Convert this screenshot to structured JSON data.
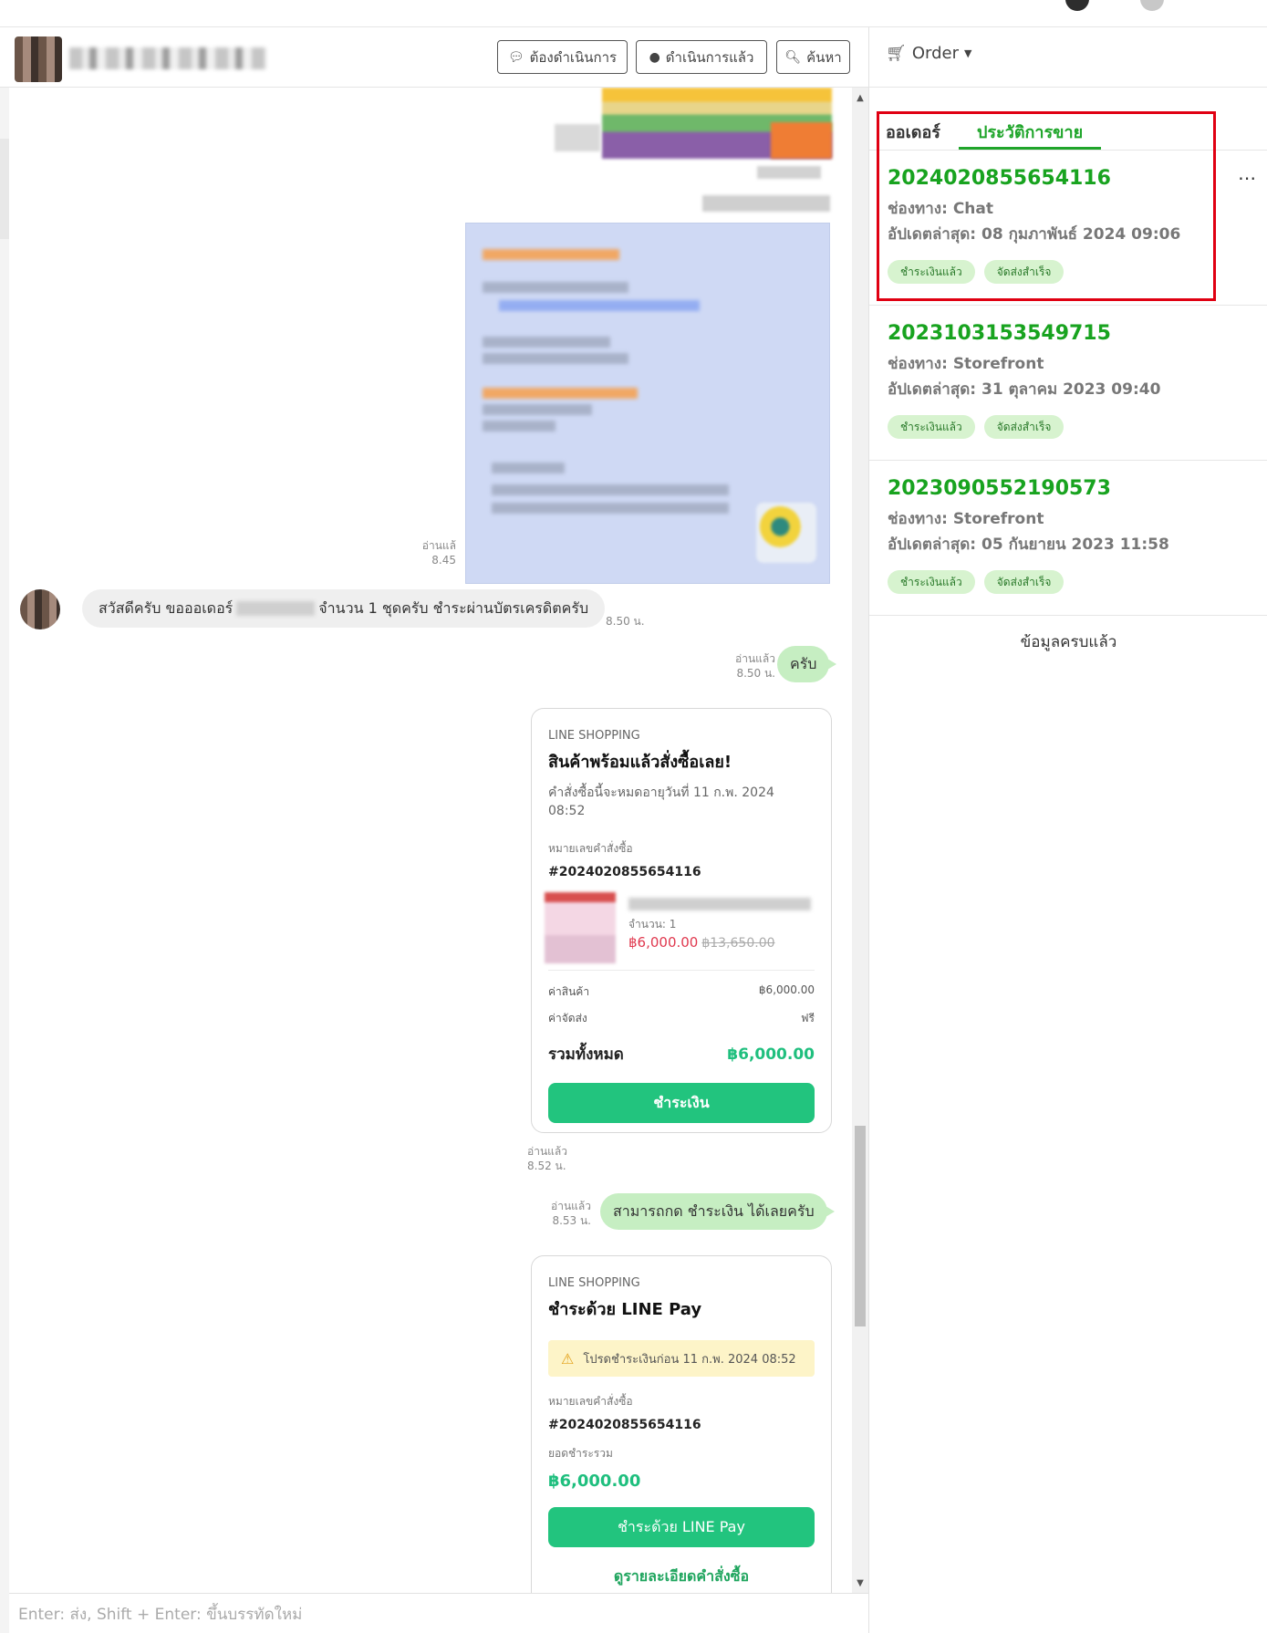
{
  "header": {
    "btn_pending": "ต้องดำเนินการ",
    "btn_done": "ดำเนินการแล้ว",
    "btn_search": "ค้นหา"
  },
  "chat": {
    "read_1_label": "อ่านแล้",
    "read_1_time": "8.45",
    "incoming_msg_a": "สวัสดีครับ ขอออเดอร์",
    "incoming_msg_b": "จำนวน 1 ชุดครับ ชำระผ่านบัตรเครดิตครับ",
    "incoming_time": "8.50 น.",
    "read_2_label": "อ่านแล้ว",
    "read_2_time": "8.50 น.",
    "out_1": "ครับ",
    "card1": {
      "source": "LINE SHOPPING",
      "title": "สินค้าพร้อมแล้วสั่งซื้อเลย!",
      "expiry": "คำสั่งซื้อนี้จะหมดอายุวันที่ 11 ก.พ. 2024 08:52",
      "order_label": "หมายเลขคำสั่งซื้อ",
      "order_no": "#2024020855654116",
      "qty": "จำนวน: 1",
      "price": "฿6,000.00",
      "price_old": "฿13,650.00",
      "subtotal_label": "ค่าสินค้า",
      "subtotal_value": "฿6,000.00",
      "shipping_label": "ค่าจัดส่ง",
      "shipping_value": "ฟรี",
      "total_label": "รวมทั้งหมด",
      "total_value": "฿6,000.00",
      "pay_button": "ชำระเงิน"
    },
    "read_3_label": "อ่านแล้ว",
    "read_3_time": "8.52 น.",
    "read_4_label": "อ่านแล้ว",
    "read_4_time": "8.53 น.",
    "out_2": "สามารถกด ชำระเงิน ได้เลยครับ",
    "card2": {
      "source": "LINE SHOPPING",
      "title": "ชำระด้วย LINE Pay",
      "warning": "โปรดชำระเงินก่อน 11 ก.พ. 2024 08:52",
      "order_label": "หมายเลขคำสั่งซื้อ",
      "order_no": "#2024020855654116",
      "amount_label": "ยอดชำระรวม",
      "amount": "฿6,000.00",
      "pay_button": "ชำระด้วย LINE Pay",
      "detail_link": "ดูรายละเอียดคำสั่งซื้อ"
    },
    "input_placeholder": "Enter: ส่ง, Shift + Enter: ขึ้นบรรทัดใหม่"
  },
  "right": {
    "order_menu": "Order",
    "tab_orders": "ออเดอร์",
    "tab_history": "ประวัติการขาย",
    "orders": [
      {
        "id": "2024020855654116",
        "channel": "ช่องทาง: Chat",
        "updated": "อัปเดตล่าสุด: 08 กุมภาพันธ์ 2024 09:06",
        "badge_paid": "ชำระเงินแล้ว",
        "badge_shipped": "จัดส่งสำเร็จ"
      },
      {
        "id": "2023103153549715",
        "channel": "ช่องทาง: Storefront",
        "updated": "อัปเดตล่าสุด: 31 ตุลาคม 2023 09:40",
        "badge_paid": "ชำระเงินแล้ว",
        "badge_shipped": "จัดส่งสำเร็จ"
      },
      {
        "id": "2023090552190573",
        "channel": "ช่องทาง: Storefront",
        "updated": "อัปเดตล่าสุด: 05 กันยายน 2023 11:58",
        "badge_paid": "ชำระเงินแล้ว",
        "badge_shipped": "จัดส่งสำเร็จ"
      }
    ],
    "all_loaded": "ข้อมูลครบแล้ว"
  },
  "colors": {
    "accent_green": "#1fa52a",
    "button_green": "#22c47e",
    "highlight_red": "#e00012"
  }
}
